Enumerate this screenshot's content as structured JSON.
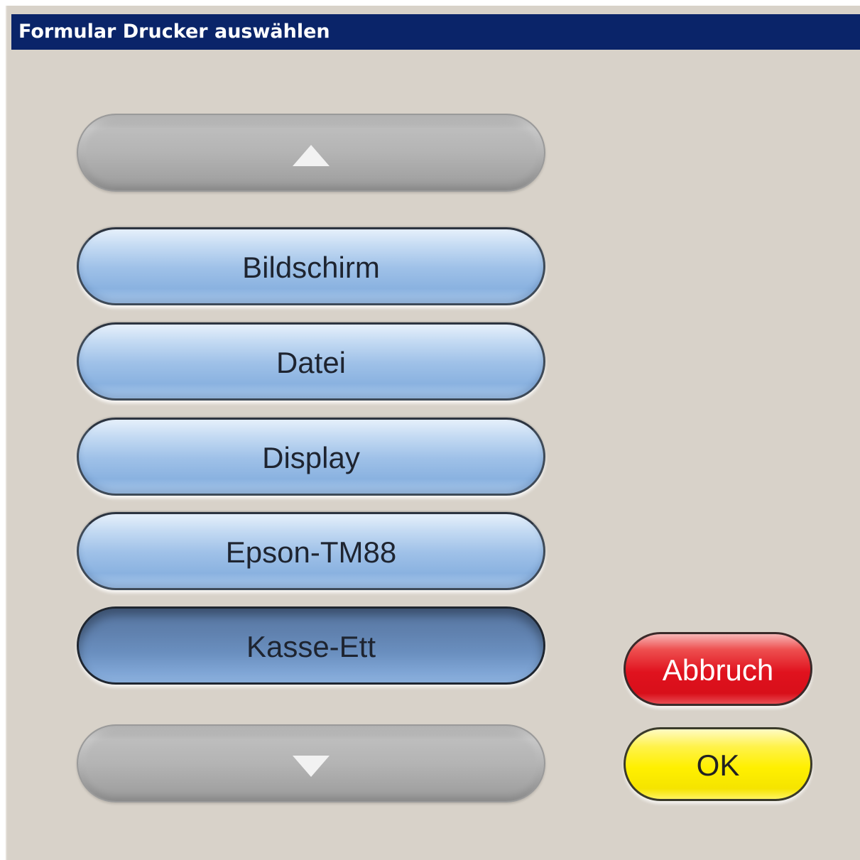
{
  "window": {
    "title": "Formular Drucker auswählen"
  },
  "list": {
    "scroll_up_icon": "triangle-up-icon",
    "scroll_down_icon": "triangle-down-icon",
    "items": [
      {
        "label": "Bildschirm",
        "selected": false
      },
      {
        "label": "Datei",
        "selected": false
      },
      {
        "label": "Display",
        "selected": false
      },
      {
        "label": "Epson-TM88",
        "selected": false
      },
      {
        "label": "Kasse-Ett",
        "selected": true
      }
    ]
  },
  "actions": {
    "cancel_label": "Abbruch",
    "ok_label": "OK"
  },
  "colors": {
    "titlebar": "#0a2469",
    "background": "#d8d2c9",
    "item": "#9fc1e8",
    "item_selected": "#6a8fbf",
    "cancel": "#e0121e",
    "ok": "#fff000"
  }
}
